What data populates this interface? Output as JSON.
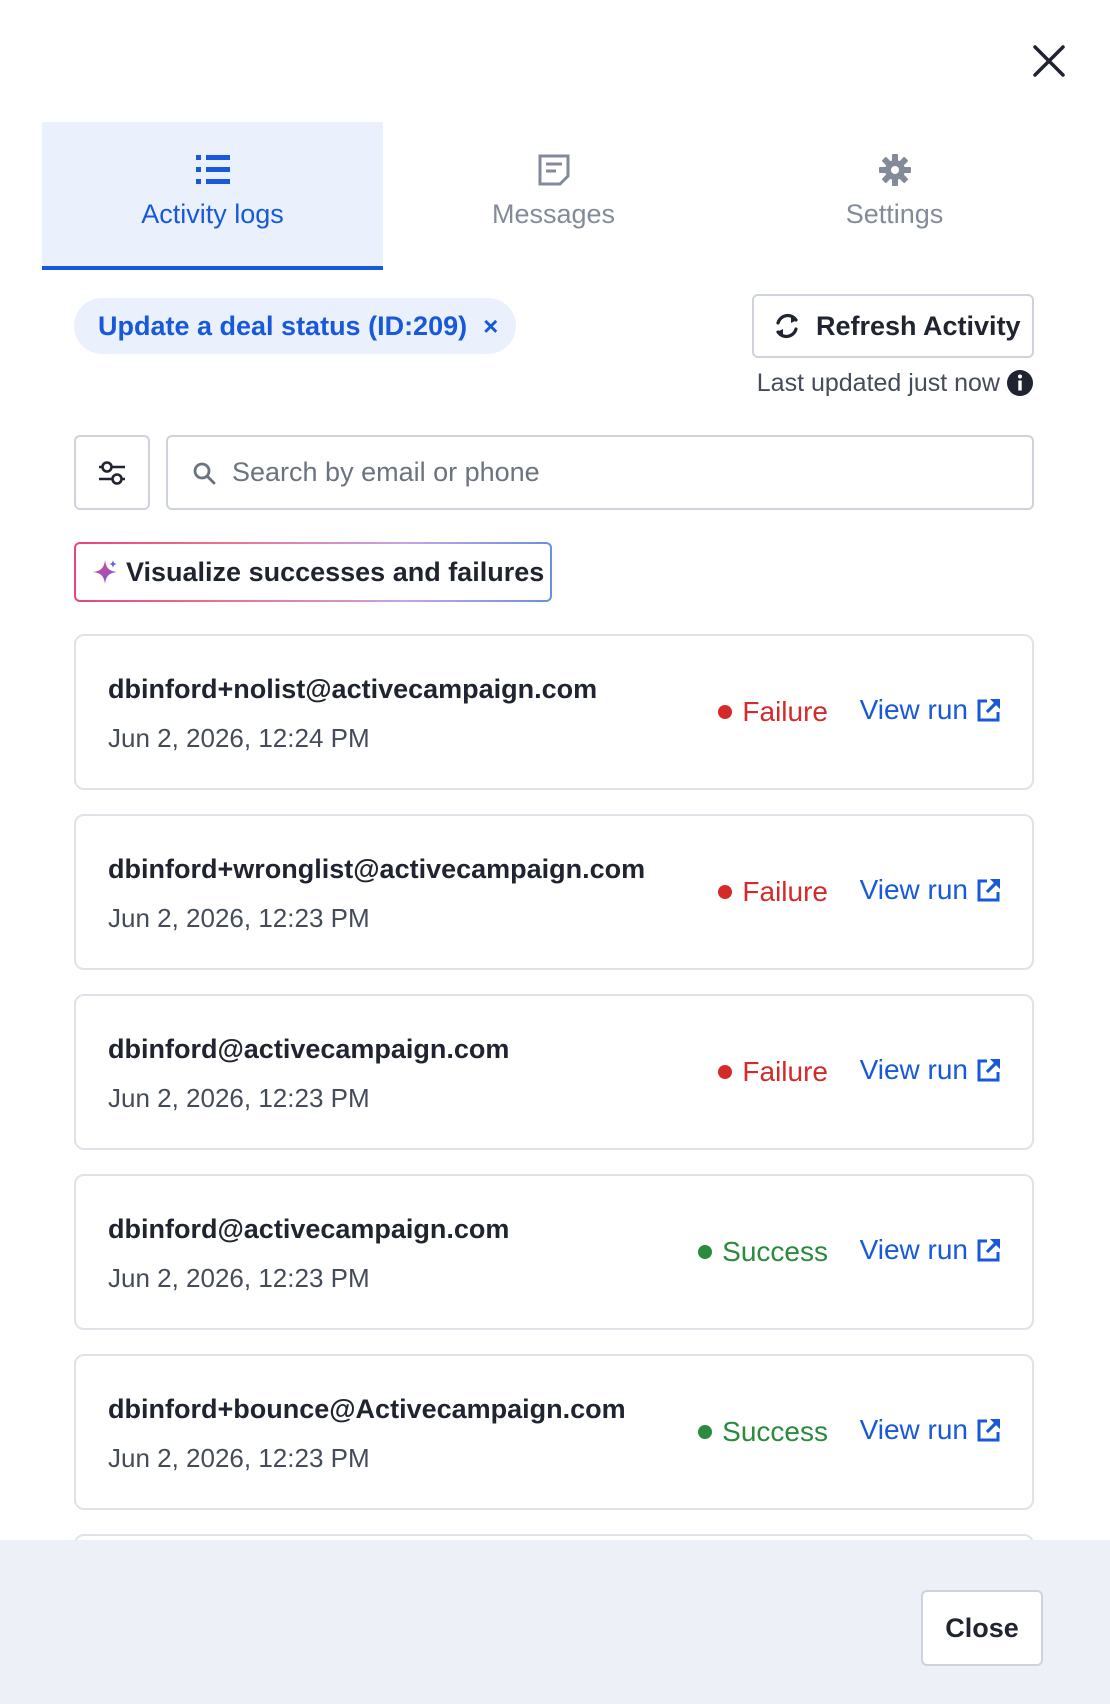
{
  "tabs": [
    {
      "label": "Activity logs",
      "icon": "list-icon",
      "active": true
    },
    {
      "label": "Messages",
      "icon": "message-icon",
      "active": false
    },
    {
      "label": "Settings",
      "icon": "gear-icon",
      "active": false
    }
  ],
  "filter_chip": {
    "label": "Update a deal status (ID:209)",
    "remove": "×"
  },
  "refresh": {
    "label": "Refresh Activity",
    "last_updated": "Last updated just now"
  },
  "search": {
    "placeholder": "Search by email or phone",
    "value": ""
  },
  "visualize": {
    "label": "Visualize successes and failures"
  },
  "logs": [
    {
      "email": "dbinford+nolist@activecampaign.com",
      "date": "Jun 2, 2026, 12:24 PM",
      "status": "Failure",
      "link": "View run"
    },
    {
      "email": "dbinford+wronglist@activecampaign.com",
      "date": "Jun 2, 2026, 12:23 PM",
      "status": "Failure",
      "link": "View run"
    },
    {
      "email": "dbinford@activecampaign.com",
      "date": "Jun 2, 2026, 12:23 PM",
      "status": "Failure",
      "link": "View run"
    },
    {
      "email": "dbinford@activecampaign.com",
      "date": "Jun 2, 2026, 12:23 PM",
      "status": "Success",
      "link": "View run"
    },
    {
      "email": "dbinford+bounce@Activecampaign.com",
      "date": "Jun 2, 2026, 12:23 PM",
      "status": "Success",
      "link": "View run"
    }
  ],
  "footer": {
    "close_label": "Close"
  },
  "colors": {
    "accent": "#1859db",
    "failure": "#d42a2a",
    "success": "#2a8a3e",
    "tab_active_bg": "#eaf1fc",
    "footer_bg": "#edf0f6"
  }
}
